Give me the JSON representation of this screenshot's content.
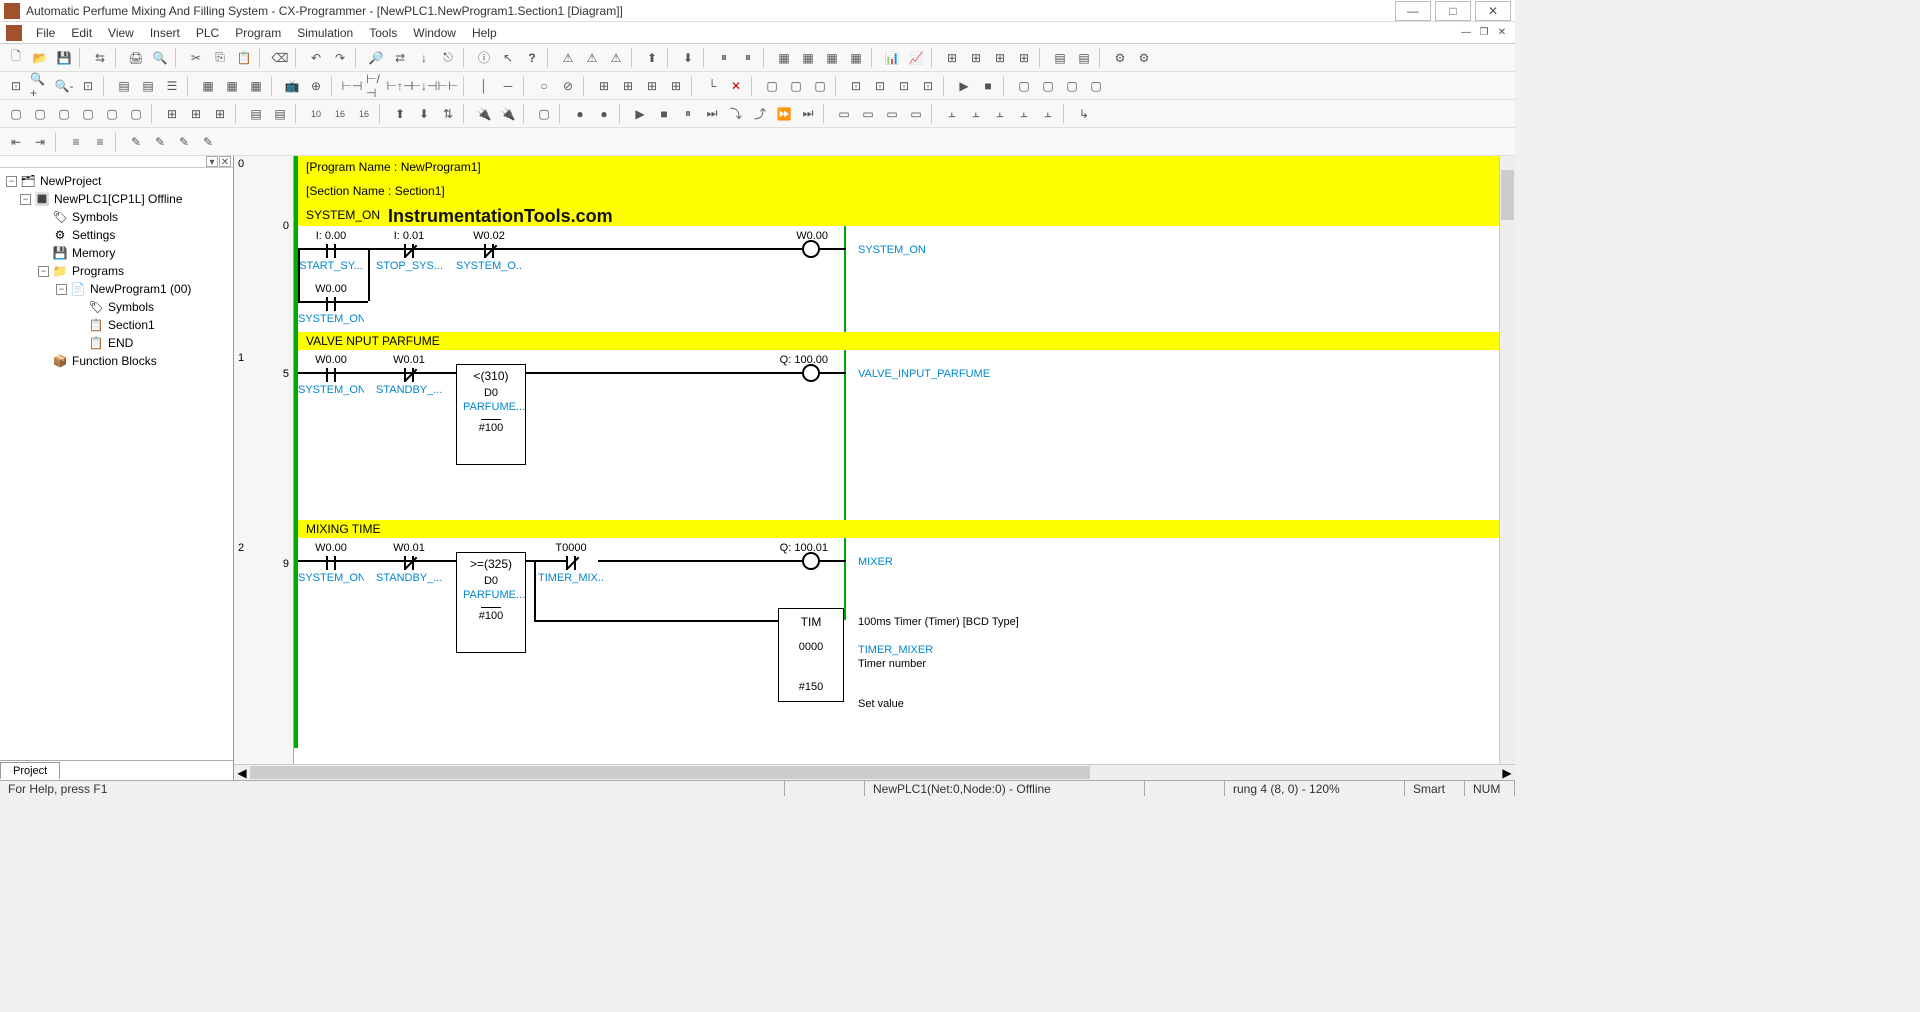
{
  "window": {
    "title": "Automatic Perfume Mixing And Filling System - CX-Programmer - [NewPLC1.NewProgram1.Section1 [Diagram]]"
  },
  "menu": {
    "file": "File",
    "edit": "Edit",
    "view": "View",
    "insert": "Insert",
    "plc": "PLC",
    "program": "Program",
    "simulation": "Simulation",
    "tools": "Tools",
    "window": "Window",
    "help": "Help"
  },
  "tree": {
    "root": "NewProject",
    "plc": "NewPLC1[CP1L] Offline",
    "symbols": "Symbols",
    "settings": "Settings",
    "memory": "Memory",
    "programs": "Programs",
    "program1": "NewProgram1 (00)",
    "psymbols": "Symbols",
    "section1": "Section1",
    "end": "END",
    "fblocks": "Function Blocks",
    "tab": "Project"
  },
  "header": {
    "pname": "[Program Name : NewProgram1]",
    "sname": "[Section Name : Section1]",
    "rtitle": "SYSTEM_ON",
    "site": "InstrumentationTools.com"
  },
  "rung0": {
    "num_left": "0",
    "num_right": "0",
    "c1_addr": "I: 0.00",
    "c1_lbl": "START_SY...",
    "c2_addr": "I: 0.01",
    "c2_lbl": "STOP_SYS...",
    "c3_addr": "W0.02",
    "c3_lbl": "SYSTEM_O...",
    "c4_addr": "W0.00",
    "c4_lbl": "SYSTEM_ON",
    "coil_addr": "W0.00",
    "coil_lbl": "SYSTEM_ON"
  },
  "rung1": {
    "num_left": "1",
    "num_right": "5",
    "title": "VALVE NPUT PARFUME",
    "c1_addr": "W0.00",
    "c1_lbl": "SYSTEM_ON",
    "c2_addr": "W0.01",
    "c2_lbl": "STANDBY_...",
    "f_op": "<(310)",
    "f_d": "D0",
    "f_dl": "PARFUME...",
    "f_v": "#100",
    "coil_addr": "Q: 100.00",
    "coil_lbl": "VALVE_INPUT_PARFUME"
  },
  "rung2": {
    "num_left": "2",
    "num_right": "9",
    "title": "MIXING TIME",
    "c1_addr": "W0.00",
    "c1_lbl": "SYSTEM_ON",
    "c2_addr": "W0.01",
    "c2_lbl": "STANDBY_...",
    "f_op": ">=(325)",
    "f_d": "D0",
    "f_dl": "PARFUME...",
    "f_v": "#100",
    "t_addr": "T0000",
    "t_lbl": "TIMER_MIX...",
    "coil_addr": "Q: 100.01",
    "coil_lbl": "MIXER",
    "tim": "TIM",
    "tim_desc": "100ms Timer (Timer) [BCD Type]",
    "tim_num": "0000",
    "tim_name": "TIMER_MIXER",
    "tim_numdesc": "Timer number",
    "tim_sv": "#150",
    "tim_svdesc": "Set value"
  },
  "status": {
    "help": "For Help, press F1",
    "plc": "NewPLC1(Net:0,Node:0) - Offline",
    "rung": "rung 4 (8, 0) - 120%",
    "smart": "Smart",
    "num": "NUM"
  }
}
